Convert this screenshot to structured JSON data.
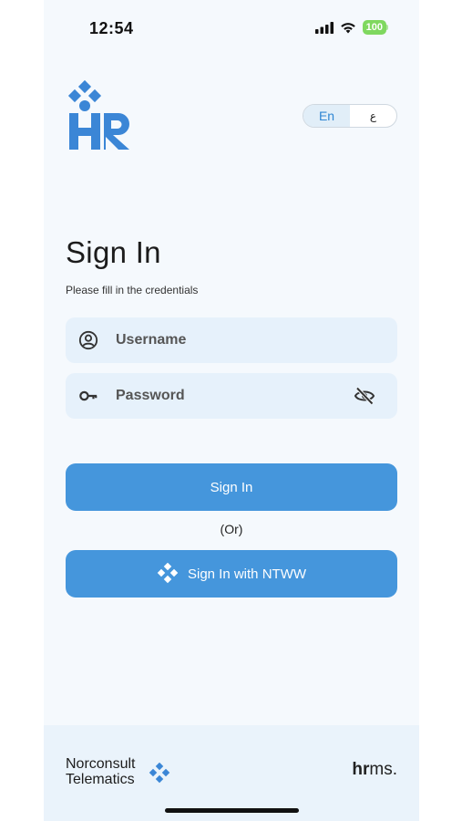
{
  "status_bar": {
    "time": "12:54",
    "battery": "100"
  },
  "header": {
    "logo_icon": "hr-logo-icon",
    "language": {
      "en_label": "En",
      "ar_label": "ع",
      "active": "En"
    }
  },
  "form": {
    "title": "Sign In",
    "subtitle": "Please fill in the credentials",
    "username_placeholder": "Username",
    "password_placeholder": "Password",
    "signin_label": "Sign In",
    "or_label": "(Or)",
    "ntww_label": "Sign In with NTWW"
  },
  "footer": {
    "company_line1": "Norconsult",
    "company_line2": "Telematics",
    "product_bold": "hr",
    "product_rest": "ms."
  },
  "colors": {
    "primary": "#4596dc",
    "field_bg": "#e6f1fb",
    "logo_blue": "#3b86d6"
  }
}
